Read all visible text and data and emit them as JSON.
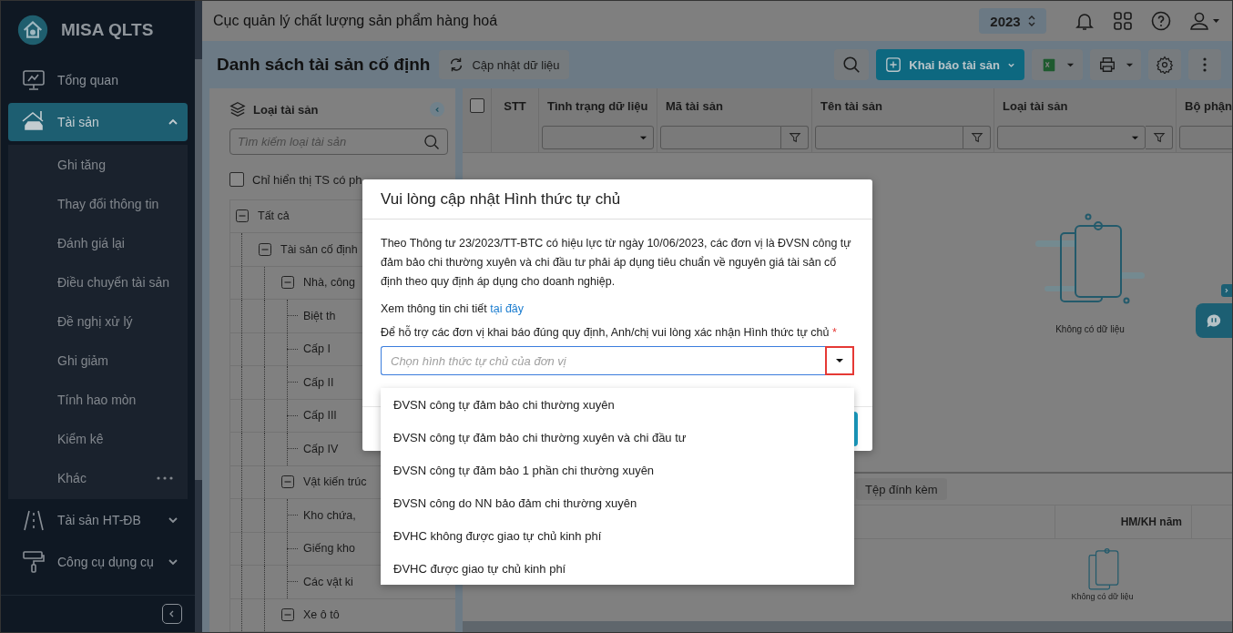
{
  "sidebar": {
    "logo_text": "MISA QLTS",
    "items": [
      {
        "label": "Tổng quan",
        "kind": "link",
        "selected": false
      },
      {
        "label": "Tài sản",
        "kind": "group",
        "selected": true,
        "expanded": true,
        "children": [
          {
            "label": "Ghi tăng"
          },
          {
            "label": "Thay đổi thông tin"
          },
          {
            "label": "Đánh giá lại"
          },
          {
            "label": "Điều chuyển tài sản"
          },
          {
            "label": "Đề nghị xử lý"
          },
          {
            "label": "Ghi giảm"
          },
          {
            "label": "Tính hao mòn"
          },
          {
            "label": "Kiểm kê"
          },
          {
            "label": "Khác",
            "kind": "more"
          }
        ]
      },
      {
        "label": "Tài sản HT-ĐB",
        "kind": "group",
        "selected": false,
        "expanded": false
      },
      {
        "label": "Công cụ dụng cụ",
        "kind": "group",
        "selected": false,
        "expanded": false
      }
    ]
  },
  "top_bar": {
    "title": "Cục quản lý chất lượng sản phẩm hàng hoá",
    "year": "2023"
  },
  "page": {
    "title": "Danh sách tài sản cố định",
    "refresh_button": "Cập nhật dữ liệu",
    "add_button": "Khai báo tài sản"
  },
  "tree": {
    "title": "Loại tài sản",
    "search": {
      "placeholder": "Tìm kiếm loại tài sản"
    },
    "filter_label": "Chỉ hiển thị TS có ph",
    "filter_checked": false,
    "items": [
      {
        "label": "Tất cả",
        "expanded": true,
        "children": [
          {
            "label": "Tài sản cố định",
            "expanded": true,
            "children": [
              {
                "label": "Nhà, công",
                "expanded": true,
                "children": [
                  {
                    "label": "Biệt th"
                  },
                  {
                    "label": "Cấp I"
                  },
                  {
                    "label": "Cấp II"
                  },
                  {
                    "label": "Cấp III"
                  },
                  {
                    "label": "Cấp IV"
                  }
                ]
              },
              {
                "label": "Vật kiến trúc",
                "expanded": true,
                "children": [
                  {
                    "label": "Kho chứa,"
                  },
                  {
                    "label": "Giếng kho"
                  },
                  {
                    "label": "Các vật ki"
                  }
                ]
              },
              {
                "label": "Xe ô tô",
                "expanded": true
              }
            ]
          }
        ]
      }
    ]
  },
  "table": {
    "select_all_checked": false,
    "columns": [
      {
        "label": "STT",
        "kind": "plain"
      },
      {
        "label": "Tình trạng dữ liệu",
        "kind": "select"
      },
      {
        "label": "Mã tài sản",
        "kind": "text"
      },
      {
        "label": "Tên tài sản",
        "kind": "text"
      },
      {
        "label": "Loại tài sản",
        "kind": "combo"
      },
      {
        "label": "Bộ phận",
        "kind": "partial"
      }
    ],
    "empty_text": "Không có dữ liệu"
  },
  "detail": {
    "tab": "Tệp đính kèm",
    "column": "HM/KH năm",
    "empty_text": "Không có dữ liệu"
  },
  "dialog": {
    "title": "Vui lòng cập nhật Hình thức tự chủ",
    "message": "Theo Thông tư 23/2023/TT-BTC có hiệu lực từ ngày 10/06/2023, các đơn vị là ĐVSN công tự đảm bảo chi thường xuyên và chi đầu tư phải áp dụng tiêu chuẩn về nguyên giá tài sản cố định theo quy định áp dụng cho doanh nghiệp.",
    "detail_text": "Xem thông tin chi tiết",
    "detail_link": "tại đây",
    "field_label": "Để hỗ trợ các đơn vị khai báo đúng quy định, Anh/chị vui lòng xác nhận Hình thức tự chủ",
    "required_mark": "*",
    "combo": {
      "placeholder": "Chọn hình thức tự chủ của đơn vị",
      "options": [
        {
          "label": "ĐVSN công tự đảm bảo chi thường xuyên",
          "selected": false
        },
        {
          "label": "ĐVSN công tự đảm bảo chi thường xuyên và chi đầu tư",
          "selected": false
        },
        {
          "label": "ĐVSN công tự đảm bảo 1 phần chi thường xuyên",
          "selected": false
        },
        {
          "label": "ĐVSN công do NN bảo đảm chi thường xuyên",
          "selected": false
        },
        {
          "label": "ĐVHC không được giao tự chủ kinh phí",
          "selected": false
        },
        {
          "label": "ĐVHC được giao tự chủ kinh phí",
          "selected": false
        }
      ]
    }
  }
}
